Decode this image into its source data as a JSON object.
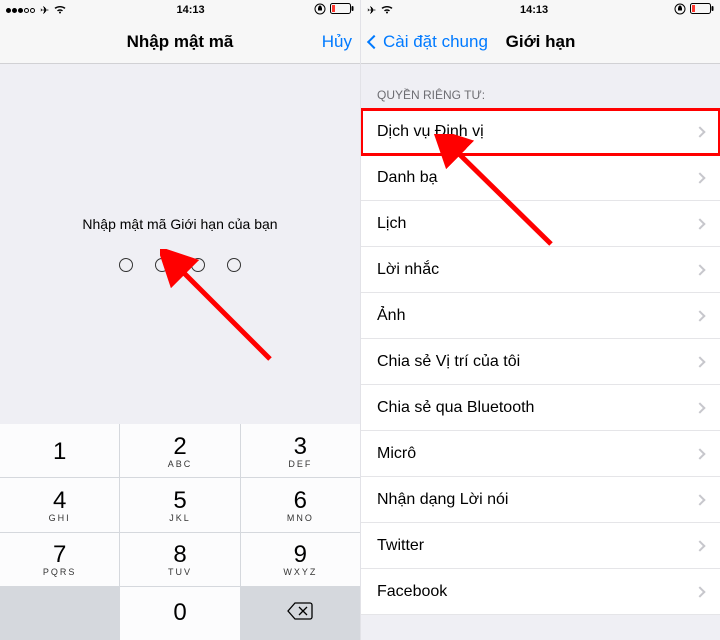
{
  "left": {
    "status": {
      "time": "14:13"
    },
    "nav": {
      "title": "Nhập mật mã",
      "cancel": "Hủy"
    },
    "prompt": "Nhập mật mã Giới hạn của bạn",
    "keys": {
      "1": {
        "num": "1",
        "letters": ""
      },
      "2": {
        "num": "2",
        "letters": "ABC"
      },
      "3": {
        "num": "3",
        "letters": "DEF"
      },
      "4": {
        "num": "4",
        "letters": "GHI"
      },
      "5": {
        "num": "5",
        "letters": "JKL"
      },
      "6": {
        "num": "6",
        "letters": "MNO"
      },
      "7": {
        "num": "7",
        "letters": "PQRS"
      },
      "8": {
        "num": "8",
        "letters": "TUV"
      },
      "9": {
        "num": "9",
        "letters": "WXYZ"
      },
      "0": {
        "num": "0",
        "letters": ""
      }
    }
  },
  "right": {
    "status": {
      "time": "14:13"
    },
    "nav": {
      "back": "Cài đặt chung",
      "title": "Giới hạn"
    },
    "section_header": "QUYỀN RIÊNG TƯ:",
    "rows": {
      "0": "Dịch vụ Định vị",
      "1": "Danh bạ",
      "2": "Lịch",
      "3": "Lời nhắc",
      "4": "Ảnh",
      "5": "Chia sẻ Vị trí của tôi",
      "6": "Chia sẻ qua Bluetooth",
      "7": "Micrô",
      "8": "Nhận dạng Lời nói",
      "9": "Twitter",
      "10": "Facebook"
    }
  }
}
